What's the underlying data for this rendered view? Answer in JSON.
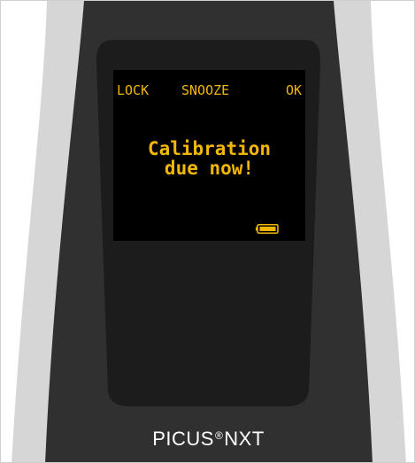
{
  "softkeys": {
    "left": "LOCK",
    "middle": "SNOOZE",
    "right": "OK"
  },
  "message": {
    "line1": "Calibration",
    "line2": "due now!"
  },
  "battery": {
    "icon": "battery-icon",
    "level": 1.0
  },
  "brand": {
    "name": "PICUS",
    "mark": "®",
    "model": "NXT"
  },
  "colors": {
    "display_text": "#f2b705",
    "body_dark": "#303030",
    "body_light": "#d6d6d6",
    "screen": "#000000"
  }
}
